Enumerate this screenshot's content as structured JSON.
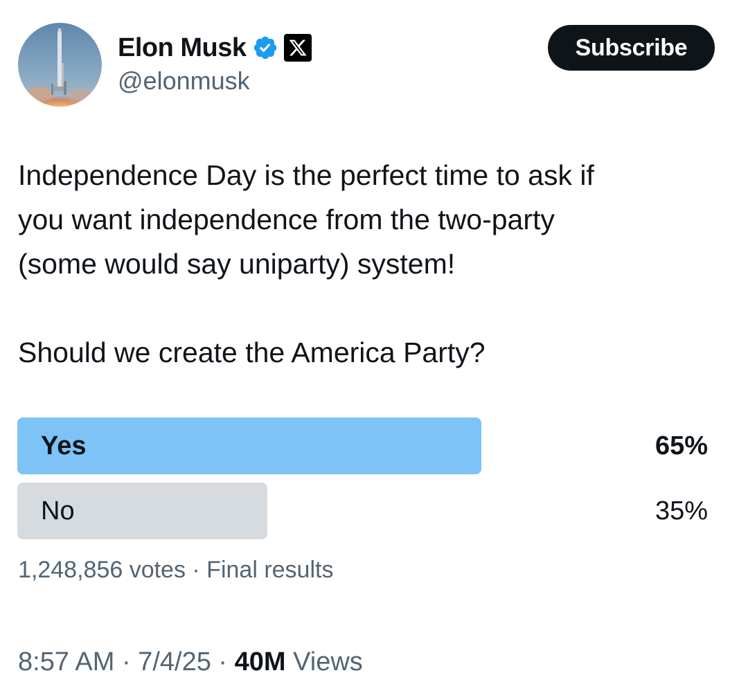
{
  "author": {
    "display_name": "Elon Musk",
    "handle": "@elonmusk",
    "verified_badge_icon": "verified-badge-icon",
    "affiliate_icon": "x-logo-icon",
    "avatar_icon": "rocket-launch-avatar"
  },
  "header": {
    "subscribe_label": "Subscribe"
  },
  "tweet": {
    "text": "Independence Day is the perfect time to ask if\nyou want independence from the two-party\n(some would say uniparty) system!\n\nShould we create the America Party?"
  },
  "poll": {
    "options": [
      {
        "label": "Yes",
        "percent_text": "65%",
        "percent": 65,
        "winner": true,
        "color": "#7dc3f5"
      },
      {
        "label": "No",
        "percent_text": "35%",
        "percent": 35,
        "winner": false,
        "color": "#d6dbdf"
      }
    ],
    "summary": "1,248,856 votes · Final results"
  },
  "meta": {
    "time": "8:57 AM",
    "separator": " · ",
    "date": "7/4/25",
    "views_count": "40M",
    "views_label": " Views"
  },
  "colors": {
    "verified_blue": "#1d9bf0",
    "secondary_text": "#536471",
    "primary_text": "#0f1419"
  }
}
